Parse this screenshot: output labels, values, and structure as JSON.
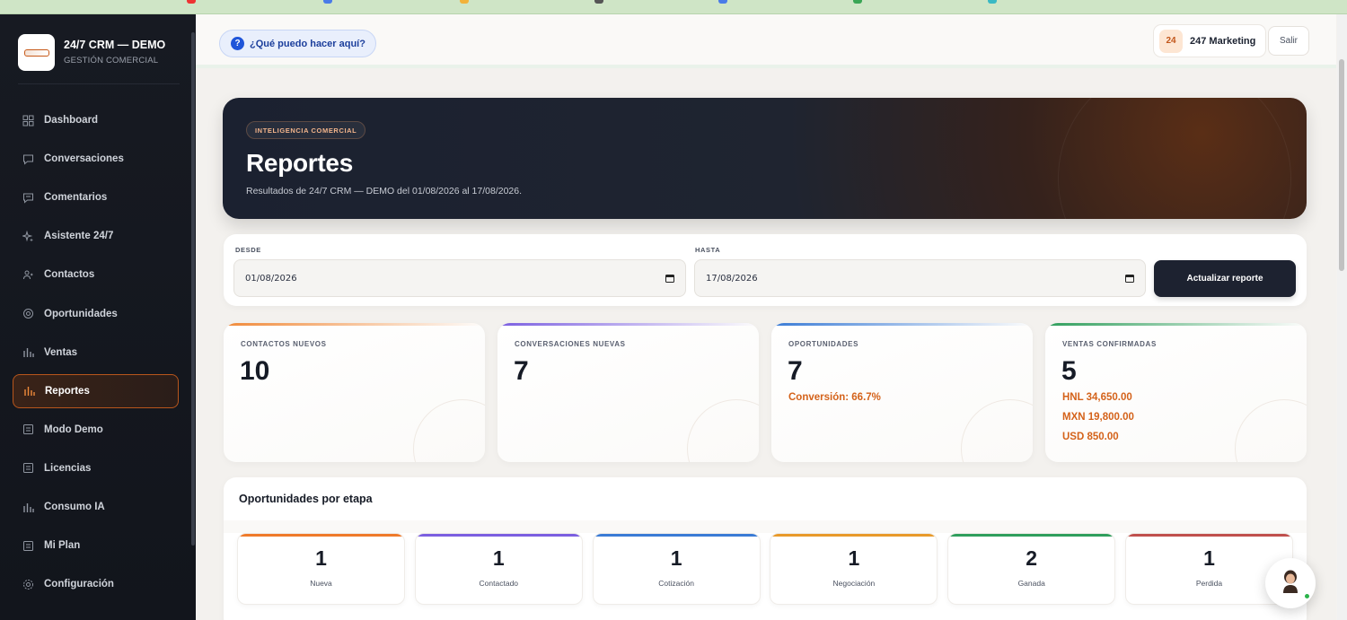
{
  "brand": {
    "title": "24/7 CRM — DEMO",
    "subtitle": "GESTIÓN COMERCIAL"
  },
  "sidebar": {
    "items": [
      {
        "label": "Dashboard",
        "icon": "grid-icon"
      },
      {
        "label": "Conversaciones",
        "icon": "chat-icon"
      },
      {
        "label": "Comentarios",
        "icon": "comment-icon"
      },
      {
        "label": "Asistente 24/7",
        "icon": "sparkle-icon"
      },
      {
        "label": "Contactos",
        "icon": "users-icon"
      },
      {
        "label": "Oportunidades",
        "icon": "target-icon"
      },
      {
        "label": "Ventas",
        "icon": "bar-chart-icon"
      },
      {
        "label": "Reportes",
        "icon": "bar-chart-icon",
        "active": true
      },
      {
        "label": "Modo Demo",
        "icon": "document-icon"
      },
      {
        "label": "Licencias",
        "icon": "document-icon"
      },
      {
        "label": "Consumo IA",
        "icon": "bar-chart-icon"
      },
      {
        "label": "Mi Plan",
        "icon": "document-icon"
      },
      {
        "label": "Configuración",
        "icon": "gear-icon"
      }
    ]
  },
  "topbar": {
    "help_label": "¿Qué puedo hacer aquí?",
    "user_initials": "24",
    "user_name": "247 Marketing",
    "logout_label": "Salir"
  },
  "hero": {
    "badge": "INTELIGENCIA COMERCIAL",
    "title": "Reportes",
    "subtitle": "Resultados de 24/7 CRM — DEMO del 01/08/2026 al 17/08/2026."
  },
  "filters": {
    "from_label": "DESDE",
    "from_value": "01/08/2026",
    "to_label": "HASTA",
    "to_value": "17/08/2026",
    "update_label": "Actualizar reporte"
  },
  "kpis": [
    {
      "label": "CONTACTOS NUEVOS",
      "value": "10",
      "color": "#f08a3a",
      "extra": []
    },
    {
      "label": "CONVERSACIONES NUEVAS",
      "value": "7",
      "color": "#7b5fe0",
      "extra": []
    },
    {
      "label": "OPORTUNIDADES",
      "value": "7",
      "color": "#3a7bd5",
      "extra": [
        "Conversión: 66.7%"
      ]
    },
    {
      "label": "VENTAS CONFIRMADAS",
      "value": "5",
      "color": "#2f9e5c",
      "extra": [
        "HNL 34,650.00",
        "MXN 19,800.00",
        "USD 850.00"
      ]
    }
  ],
  "stages": {
    "title": "Oportunidades por etapa",
    "items": [
      {
        "count": "1",
        "label": "Nueva",
        "color": "#ef7a2a"
      },
      {
        "count": "1",
        "label": "Contactado",
        "color": "#7b5fe0"
      },
      {
        "count": "1",
        "label": "Cotización",
        "color": "#3a7bd5"
      },
      {
        "count": "1",
        "label": "Negociación",
        "color": "#e89a2a"
      },
      {
        "count": "2",
        "label": "Ganada",
        "color": "#2f9e5c"
      },
      {
        "count": "1",
        "label": "Perdida",
        "color": "#c0504d"
      }
    ]
  },
  "colors": {
    "accent": "#d4621a",
    "sidebar_bg": "#171a22",
    "hero_bg": "#1f2430"
  }
}
